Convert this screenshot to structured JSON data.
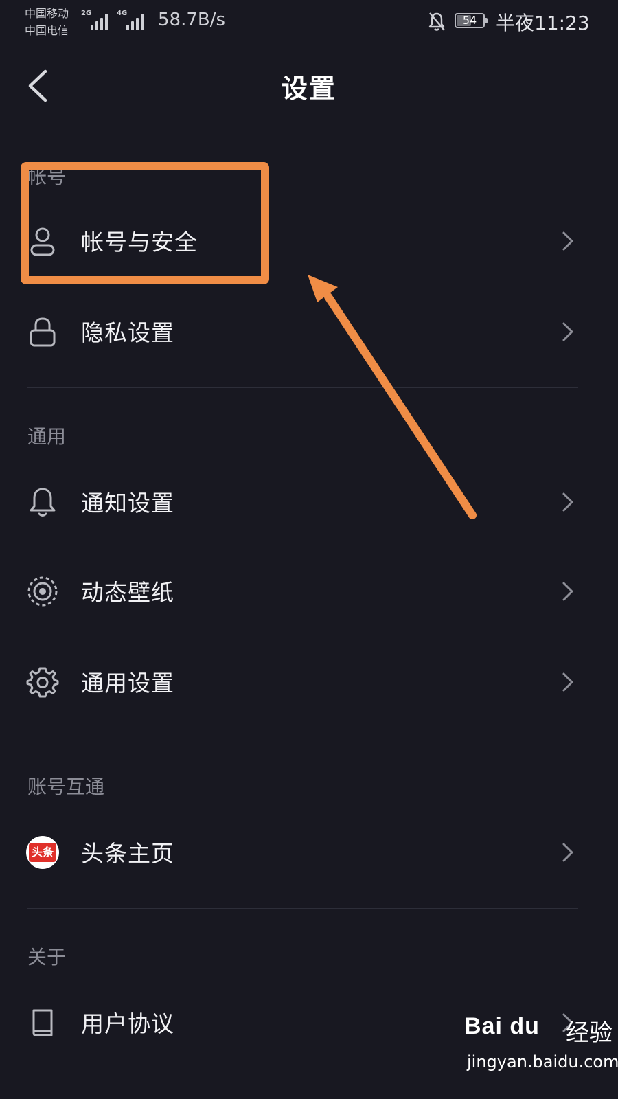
{
  "status_bar": {
    "carrier_1": "中国移动",
    "carrier_2": "中国电信",
    "sig1_tag": "2G",
    "sig2_tag": "4G",
    "net_speed": "58.7B/s",
    "battery": "54",
    "time": "半夜11:23"
  },
  "header": {
    "title": "设置",
    "back_icon": "chevron-left-icon"
  },
  "sections": [
    {
      "title": "帐号",
      "items": [
        {
          "label": "帐号与安全",
          "icon": "user-icon"
        },
        {
          "label": "隐私设置",
          "icon": "lock-icon"
        }
      ]
    },
    {
      "title": "通用",
      "items": [
        {
          "label": "通知设置",
          "icon": "bell-icon"
        },
        {
          "label": "动态壁纸",
          "icon": "dynamic-wallpaper-icon"
        },
        {
          "label": "通用设置",
          "icon": "gear-icon"
        }
      ]
    },
    {
      "title": "账号互通",
      "items": [
        {
          "label": "头条主页",
          "icon": "toutiao-logo",
          "badge": "头条"
        }
      ]
    },
    {
      "title": "关于",
      "items": [
        {
          "label": "用户协议",
          "icon": "book-icon"
        }
      ]
    }
  ],
  "watermark": {
    "logo": "Bai du",
    "text": "经验",
    "url": "jingyan.baidu.com"
  },
  "colors": {
    "background": "#181821",
    "highlight": "#f08d46",
    "text": "#f2f2f5",
    "section_text": "#8c8d97"
  }
}
